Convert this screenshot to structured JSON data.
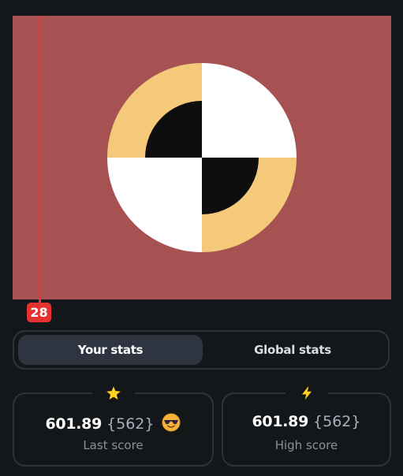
{
  "canvas": {
    "background_color": "#a65152",
    "target_colors": {
      "yellow": "#f5c97a",
      "white": "#ffffff",
      "black": "#0e0e0e"
    }
  },
  "marker": {
    "value": "28",
    "color": "#e5312f"
  },
  "tabs": [
    {
      "label": "Your stats",
      "active": true
    },
    {
      "label": "Global stats",
      "active": false
    }
  ],
  "cards": {
    "last": {
      "icon": "star-icon",
      "score": "601.89",
      "sub": "{562}",
      "emoji": "sunglasses-face-icon",
      "label": "Last score"
    },
    "high": {
      "icon": "lightning-icon",
      "score": "601.89",
      "sub": "{562}",
      "label": "High score"
    }
  }
}
